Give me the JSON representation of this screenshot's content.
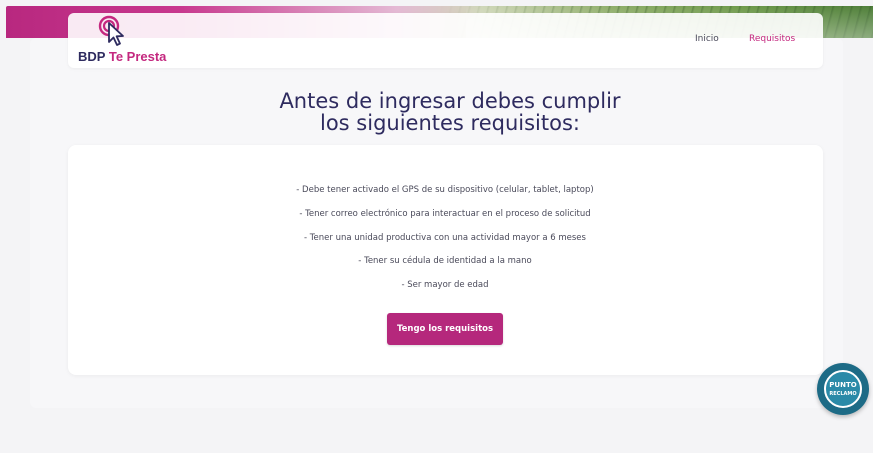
{
  "brand": {
    "name_part1": "BDP",
    "name_part2": "Te Presta",
    "color_primary": "#c4287f",
    "color_dark": "#2e2b5f"
  },
  "nav": {
    "home": "Inicio",
    "requirements": "Requisitos"
  },
  "heading": {
    "line1": "Antes de ingresar debes cumplir",
    "line2": "los siguientes requisitos:"
  },
  "requirements": [
    "- Debe tener activado el GPS de su dispositivo (celular, tablet, laptop)",
    "- Tener correo electrónico para interactuar en el proceso de solicitud",
    "- Tener una unidad productiva con una actividad mayor a 6 meses",
    "- Tener su cédula de identidad a la mano",
    "- Ser mayor de edad"
  ],
  "cta": {
    "label": "Tengo los requisitos"
  },
  "punto_reclamo": {
    "line1": "PUNTO",
    "line2": "RECLAMO"
  },
  "icons": {
    "logo": "cursor-click-icon",
    "badge": "punto-reclamo-icon"
  }
}
